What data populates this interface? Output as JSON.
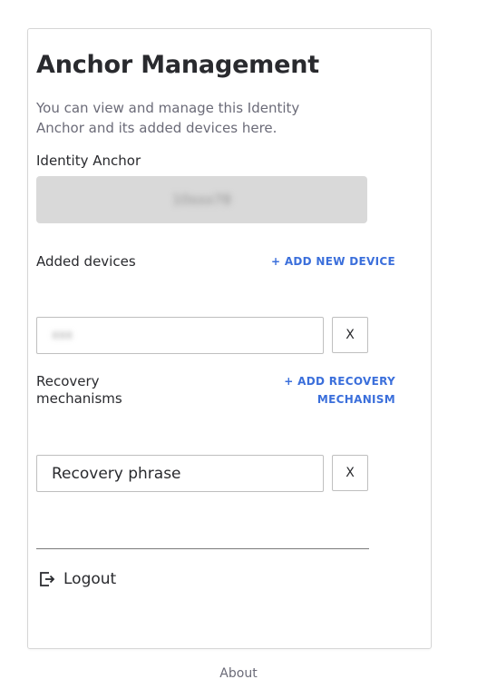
{
  "page": {
    "title": "Anchor Management",
    "description": "You can view and manage this Identity Anchor and its added devices here."
  },
  "identity_anchor": {
    "label": "Identity Anchor",
    "value": "10xxx78"
  },
  "devices": {
    "label": "Added devices",
    "add_link": "+ ADD NEW DEVICE",
    "items": [
      {
        "name": "xxx",
        "remove_label": "X"
      }
    ]
  },
  "recovery": {
    "label": "Recovery mechanisms",
    "add_link": "+ ADD RECOVERY MECHANISM",
    "items": [
      {
        "name": "Recovery phrase",
        "remove_label": "X"
      }
    ]
  },
  "footer": {
    "logout_label": "Logout",
    "about_label": "About"
  },
  "colors": {
    "accent": "#3b6fdb",
    "text": "#292a2e",
    "muted": "#6b6b78",
    "anchor_box": "#d9d9d9"
  },
  "icons": {
    "logout": "logout-icon"
  }
}
